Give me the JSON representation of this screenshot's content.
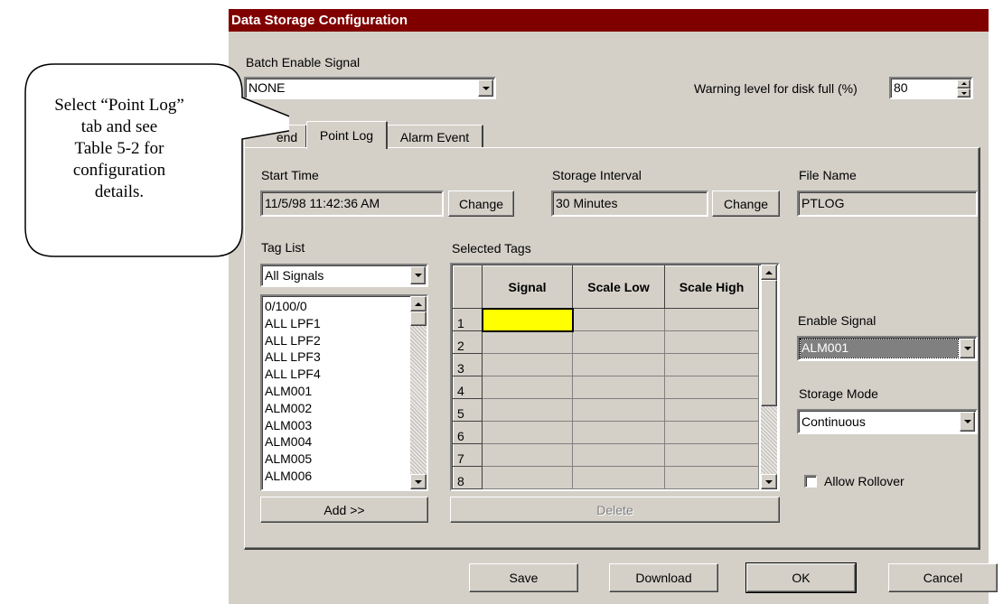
{
  "window": {
    "title": "Data Storage Configuration"
  },
  "batch_enable": {
    "label": "Batch Enable Signal",
    "value": "NONE"
  },
  "warning": {
    "label": "Warning level for disk full (%)",
    "value": "80"
  },
  "tabs": [
    {
      "label": "Trend",
      "visible_label": "end"
    },
    {
      "label": "Point Log",
      "active": true
    },
    {
      "label": "Alarm Event"
    }
  ],
  "start_time": {
    "label": "Start Time",
    "value": "11/5/98 11:42:36 AM",
    "change_label": "Change"
  },
  "storage_interval": {
    "label": "Storage Interval",
    "value": "30 Minutes",
    "change_label": "Change"
  },
  "file_name": {
    "label": "File Name",
    "value": "PTLOG"
  },
  "tag_list": {
    "label": "Tag List",
    "filter": "All Signals",
    "items": [
      "0/100/0",
      "ALL LPF1",
      "ALL LPF2",
      "ALL LPF3",
      "ALL LPF4",
      "ALM001",
      "ALM002",
      "ALM003",
      "ALM004",
      "ALM005",
      "ALM006"
    ],
    "add_label": "Add >>"
  },
  "selected_tags": {
    "label": "Selected Tags",
    "columns": [
      "Signal",
      "Scale Low",
      "Scale High"
    ],
    "rows": [
      "1",
      "2",
      "3",
      "4",
      "5",
      "6",
      "7",
      "8"
    ],
    "delete_label": "Delete"
  },
  "enable_signal": {
    "label": "Enable Signal",
    "value": "ALM001"
  },
  "storage_mode": {
    "label": "Storage Mode",
    "value": "Continuous"
  },
  "allow_rollover": {
    "label": "Allow Rollover",
    "checked": false
  },
  "footer": {
    "save": "Save",
    "download": "Download",
    "ok": "OK",
    "cancel": "Cancel"
  },
  "callout": {
    "lines": [
      "Select “Point Log”",
      "tab and see",
      "Table 5-2 for",
      "configuration",
      "details."
    ]
  },
  "colors": {
    "titlebar": "#800000",
    "face": "#d4d0c8",
    "highlight": "#808080",
    "selected_cell": "#ffff00"
  }
}
